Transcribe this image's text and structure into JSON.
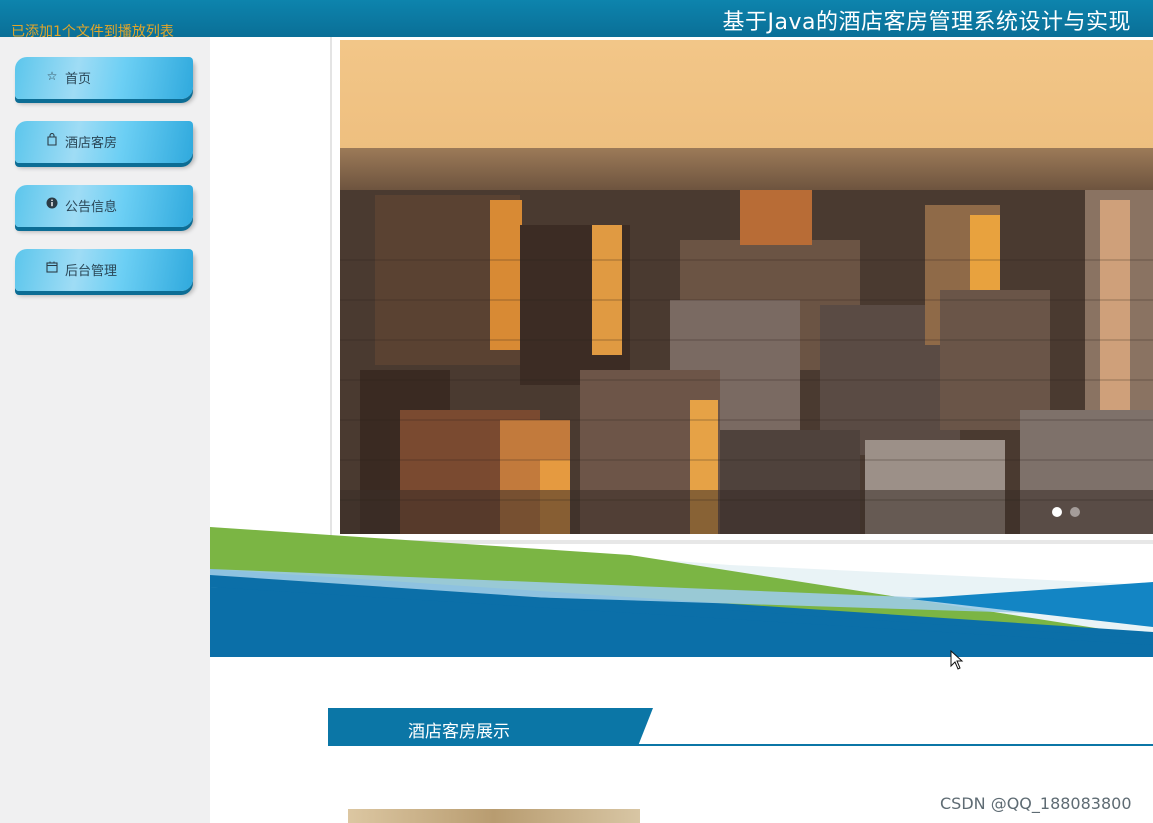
{
  "header": {
    "title": "基于Java的酒店客房管理系统设计与实现"
  },
  "overlay": {
    "message": "已添加1个文件到播放列表"
  },
  "sidebar": {
    "items": [
      {
        "label": "首页",
        "icon": "star-icon"
      },
      {
        "label": "酒店客房",
        "icon": "bag-icon"
      },
      {
        "label": "公告信息",
        "icon": "info-icon"
      },
      {
        "label": "后台管理",
        "icon": "panel-icon"
      }
    ]
  },
  "carousel": {
    "slide_count": 2,
    "active_index": 0
  },
  "section": {
    "title": "酒店客房展示"
  },
  "watermark": {
    "text": "CSDN @QQ_188083800"
  },
  "colors": {
    "header": "#0a7aa3",
    "nav_button": "#5cc6ec",
    "section_bar": "#0b76a6",
    "banner_blue": "#0b6fa8",
    "banner_green": "#7bb544"
  }
}
